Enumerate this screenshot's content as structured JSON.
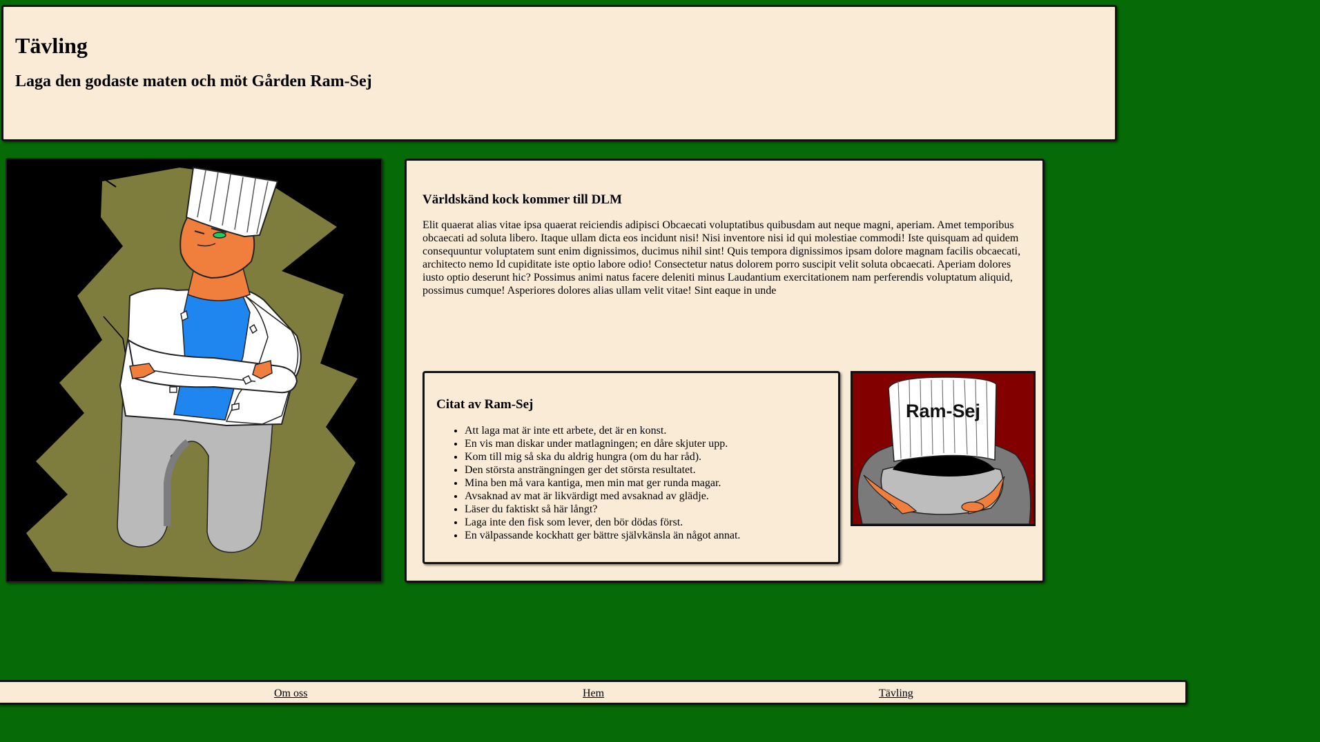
{
  "header": {
    "title": "Tävling",
    "subtitle": "Laga den godaste maten och möt Gården Ram-Sej"
  },
  "article": {
    "heading": "Världskänd kock kommer till DLM",
    "body": "Elit quaerat alias vitae ipsa quaerat reiciendis adipisci Obcaecati voluptatibus quibusdam aut neque magni, aperiam. Amet temporibus obcaecati ad soluta libero. Itaque ullam dicta eos incidunt nisi! Nisi inventore nisi id qui molestiae commodi! Iste quisquam ad quidem consequuntur voluptatem sunt enim dignissimos, ducimus nihil sint! Quis tempora dignissimos ipsam dolore magnam facilis obcaecati, architecto nemo Id cupiditate iste optio labore odio! Consectetur natus dolorem porro suscipit velit soluta obcaecati. Aperiam dolores iusto optio deserunt hic? Possimus animi natus facere deleniti minus Laudantium exercitationem nam perferendis voluptatum aliquid, possimus cumque! Asperiores dolores alias ullam velit vitae! Sint eaque in unde"
  },
  "quotes": {
    "heading": "Citat av Ram-Sej",
    "items": [
      "Att laga mat är inte ett arbete, det är en konst.",
      "En vis man diskar under matlagningen; en dåre skjuter upp.",
      "Kom till mig så ska du aldrig hungra (om du har råd).",
      "Den största ansträngningen ger det största resultatet.",
      "Mina ben må vara kantiga, men min mat ger runda magar.",
      "Avsaknad av mat är likvärdigt med avsaknad av glädje.",
      "Läser du faktiskt så här långt?",
      "Laga inte den fisk som lever, den bör dödas först.",
      "En välpassande kockhatt ger bättre självkänsla än något annat."
    ]
  },
  "badge": {
    "label": "Ram-Sej"
  },
  "footer": {
    "links": [
      "Om oss",
      "Hem",
      "Tävling"
    ]
  },
  "colors": {
    "page_background": "#066b06",
    "panel_background": "#faebd7",
    "badge_background": "#820000",
    "chef_skin": "#f07e3c",
    "chef_shirt": "#1f86ef",
    "chef_backdrop": "#7e7d3e"
  }
}
